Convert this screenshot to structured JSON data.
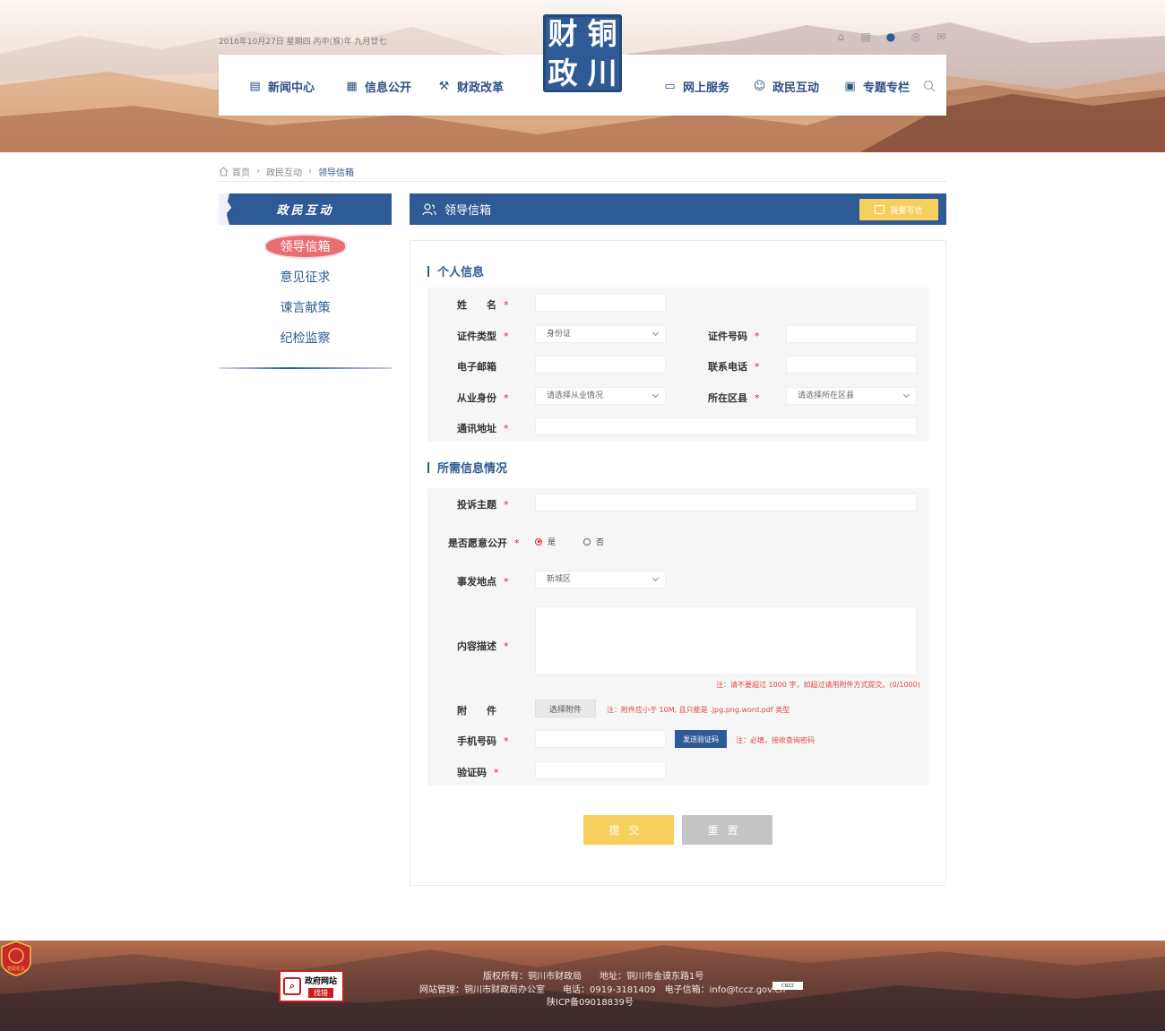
{
  "header": {
    "date": "2016年10月27日 星期四 丙申(猴)年 九月廿七",
    "logo_chars": [
      "财",
      "铜",
      "政",
      "川"
    ],
    "top_icons": [
      "home-icon",
      "mobile-site-icon",
      "wechat-icon",
      "weibo-icon",
      "mail-icon"
    ],
    "nav": [
      {
        "label": "新闻中心",
        "icon": "news-icon"
      },
      {
        "label": "信息公开",
        "icon": "document-icon"
      },
      {
        "label": "财政改革",
        "icon": "hammer-icon"
      },
      {
        "label": "网上服务",
        "icon": "monitor-icon"
      },
      {
        "label": "政民互动",
        "icon": "people-icon"
      },
      {
        "label": "专题专栏",
        "icon": "column-icon"
      }
    ]
  },
  "breadcrumb": {
    "home": "首页",
    "level1": "政民互动",
    "current": "领导信箱"
  },
  "sidebar": {
    "title": "政民互动",
    "items": [
      {
        "label": "领导信箱",
        "active": true
      },
      {
        "label": "意见征求",
        "active": false
      },
      {
        "label": "谏言献策",
        "active": false
      },
      {
        "label": "纪检监察",
        "active": false
      }
    ]
  },
  "main": {
    "title": "领导信箱",
    "write_button": "我要写信",
    "section1_title": "个人信息",
    "section2_title": "所需信息情况",
    "fields": {
      "name": {
        "label": "姓　　名",
        "required": "*"
      },
      "id_type": {
        "label": "证件类型",
        "required": "*",
        "value": "身份证"
      },
      "id_number": {
        "label": "证件号码",
        "required": "*"
      },
      "email": {
        "label": "电子邮箱"
      },
      "phone": {
        "label": "联系电话",
        "required": "*"
      },
      "occupation": {
        "label": "从业身份",
        "required": "*",
        "value": "请选择从业情况"
      },
      "district": {
        "label": "所在区县",
        "required": "*",
        "value": "请选择所在区县"
      },
      "address": {
        "label": "通讯地址",
        "required": "*"
      },
      "subject": {
        "label": "投诉主题",
        "required": "*"
      },
      "public": {
        "label": "是否愿意公开",
        "required": "*",
        "options": [
          "是",
          "否"
        ],
        "selected": "是"
      },
      "location": {
        "label": "事发地点",
        "required": "*",
        "value": "新城区"
      },
      "content": {
        "label": "内容描述",
        "required": "*",
        "note": "注：请不要超过 1000 字，如超过请用附件方式提交。(0/1000)"
      },
      "attachment": {
        "label": "附　　件",
        "button": "选择附件",
        "note": "注：附件应小于 10M, 且只能是 .jpg.png.word.pdf 类型"
      },
      "mobile": {
        "label": "手机号码",
        "required": "*",
        "button": "发送验证码",
        "note": "注：必填，接收查询密码"
      },
      "captcha": {
        "label": "验证码",
        "required": "*"
      }
    },
    "submit": "提交",
    "reset": "重置",
    "colors": {
      "primary": "#2e5a95",
      "submit": "#f7cf5c",
      "reset": "#c4c4c4",
      "required": "#e02424"
    }
  },
  "footer": {
    "line1": "版权所有：铜川市财政局　　地址：铜川市金谟东路1号",
    "line2": "网站管理：铜川市财政局办公室　　电话：0919-3181409　电子信箱：info@tccz.gov.cn",
    "line3": "陕ICP备09018839号",
    "gov_site_line1": "政府网站",
    "gov_site_line2": "找错",
    "badge_text": "党政机关",
    "mini_badge": "CNZZ"
  }
}
